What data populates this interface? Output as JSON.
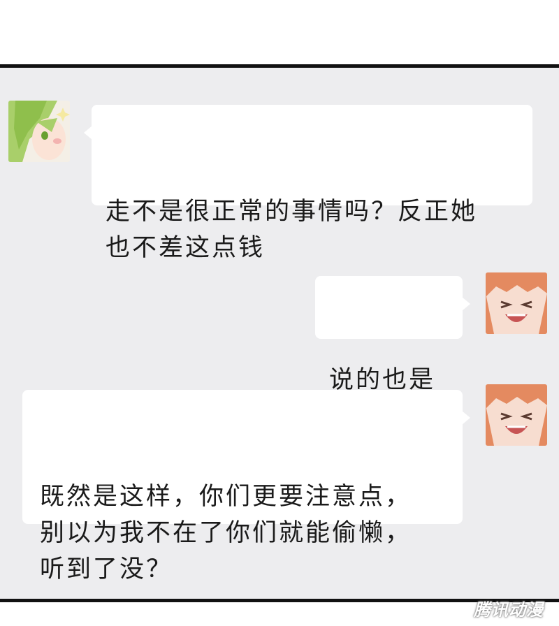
{
  "messages": [
    {
      "side": "left",
      "avatar": "green-haired-girl-avatar",
      "text": "走不是很正常的事情吗？反正她\n也不差这点钱"
    },
    {
      "side": "right",
      "avatar": "orange-haired-girl-avatar",
      "text": "说的也是"
    },
    {
      "side": "right",
      "avatar": "orange-haired-girl-avatar",
      "text": "既然是这样，你们更要注意点，\n别以为我不在了你们就能偷懒，\n听到了没？"
    }
  ],
  "watermark": "腾讯动漫",
  "colors": {
    "background": "#ededef",
    "bubble": "#ffffff",
    "border": "#111111"
  }
}
